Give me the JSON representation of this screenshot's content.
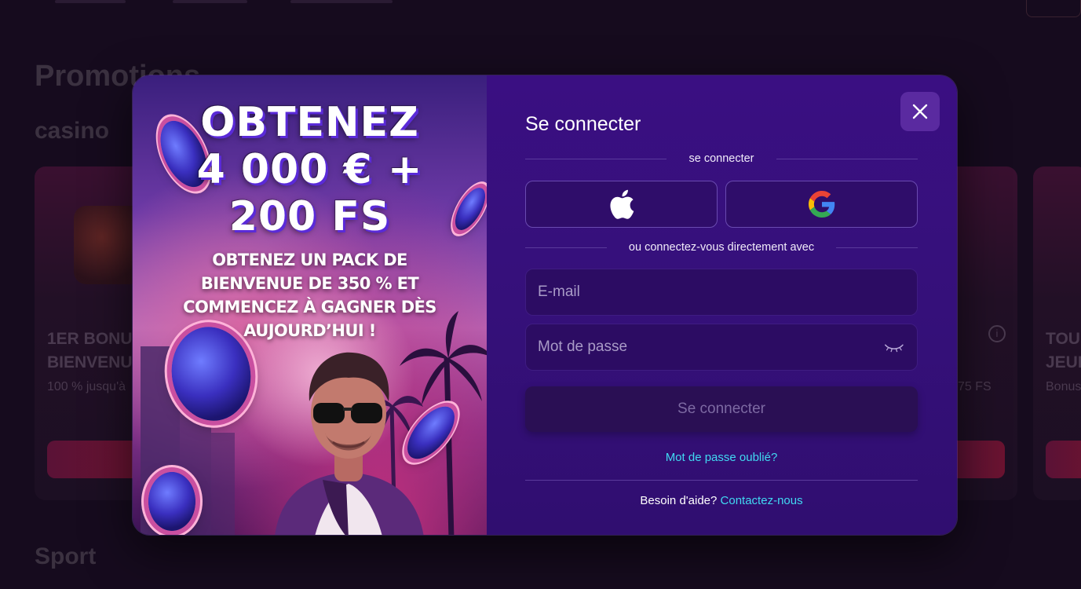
{
  "background": {
    "page_title": "Promotions",
    "section_casino": "casino",
    "section_sport": "Sport",
    "cards": [
      {
        "title": "1ER BONU\nBIENVENU",
        "subtitle": "100 % jusqu'à"
      },
      {
        "title": "",
        "subtitle": "75 FS"
      },
      {
        "title": "TOU\nJEUE",
        "subtitle": "Bonus"
      }
    ]
  },
  "promo": {
    "headline": [
      "OBTENEZ",
      "4 000 € +",
      "200 FS"
    ],
    "text": "OBTENEZ UN PACK DE BIENVENUE DE 350 % ET COMMENCEZ À GAGNER DÈS AUJOURD’HUI !"
  },
  "login": {
    "title": "Se connecter",
    "social_divider": "se connecter",
    "social_buttons": [
      {
        "name": "apple",
        "icon": "apple-icon"
      },
      {
        "name": "google",
        "icon": "google-icon"
      }
    ],
    "direct_divider": "ou connectez-vous directement avec",
    "email_placeholder": "E-mail",
    "password_placeholder": "Mot de passe",
    "submit_label": "Se connecter",
    "forgot_label": "Mot de passe oublié?",
    "help_text": "Besoin d'aide?",
    "help_link": "Contactez-nous"
  },
  "colors": {
    "accent_link": "#41d9f2",
    "modal_bg": "#3a0f82",
    "close_button": "#5a2aa0"
  }
}
